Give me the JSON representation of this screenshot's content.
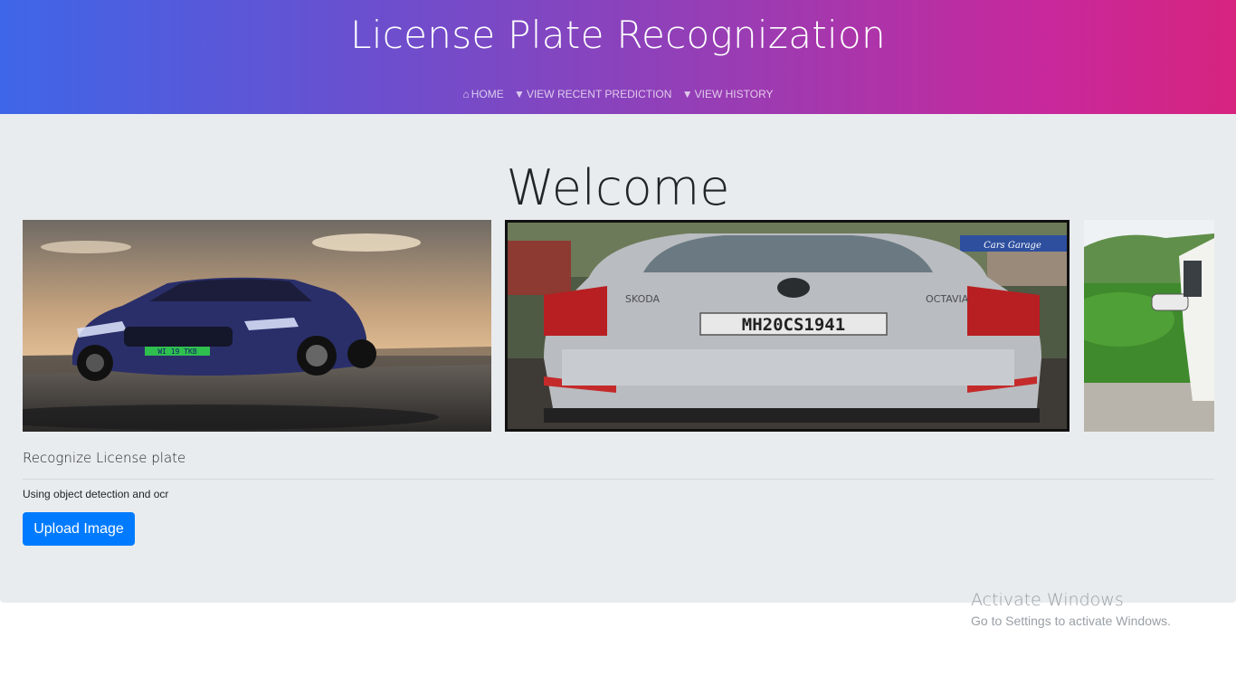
{
  "header": {
    "title": "License Plate Recognization",
    "nav": [
      {
        "label": "HOME",
        "icon": "home-icon"
      },
      {
        "label": "VIEW RECENT PREDICTION",
        "icon": "download-circle-icon"
      },
      {
        "label": "VIEW HISTORY",
        "icon": "download-circle-icon"
      }
    ],
    "gradient": [
      "#3e66e8",
      "#d6247f"
    ]
  },
  "main": {
    "welcome": "Welcome",
    "carousel": {
      "slides": [
        {
          "subject": "blue-car-front",
          "plate_text": "WI 19 TKB"
        },
        {
          "subject": "silver-car-rear",
          "plate_text": "MH20CS1941",
          "brand_left": "SKODA",
          "brand_right": "OCTAVIA",
          "watermark": "Cars Garage"
        },
        {
          "subject": "white-suv-side"
        }
      ]
    },
    "subtitle": "Recognize License plate",
    "caption": "Using object detection and ocr",
    "upload_button": "Upload Image",
    "button_color": "#007bff"
  },
  "watermark": {
    "title": "Activate Windows",
    "subtitle": "Go to Settings to activate Windows."
  }
}
